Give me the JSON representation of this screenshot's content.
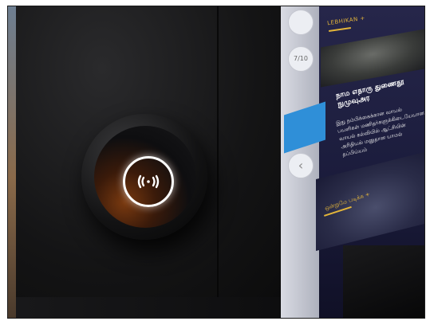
{
  "screen": {
    "tab_label": "LEBHIKAN +",
    "rail_items": [
      "",
      "7/10"
    ],
    "heading": "நாம எதாரு துணைதூ நுமுவுஅர",
    "body": "இது நம்பிக்கைக்கான வாயல் பயளிகள் மணிதர்களுக்கிடையேயான வாயல் கல்வியில் ஆட்சியின் அரிதியல் மனுதான யாமல் தப்பிய்யம்",
    "link_label": "ஒன்றுமே படிக்க +"
  },
  "reader": {
    "icon": "contactless-icon"
  },
  "colors": {
    "accent": "#e3b53a",
    "rail_blue": "#2f8fd8",
    "screen_bg": "#1f2044"
  }
}
